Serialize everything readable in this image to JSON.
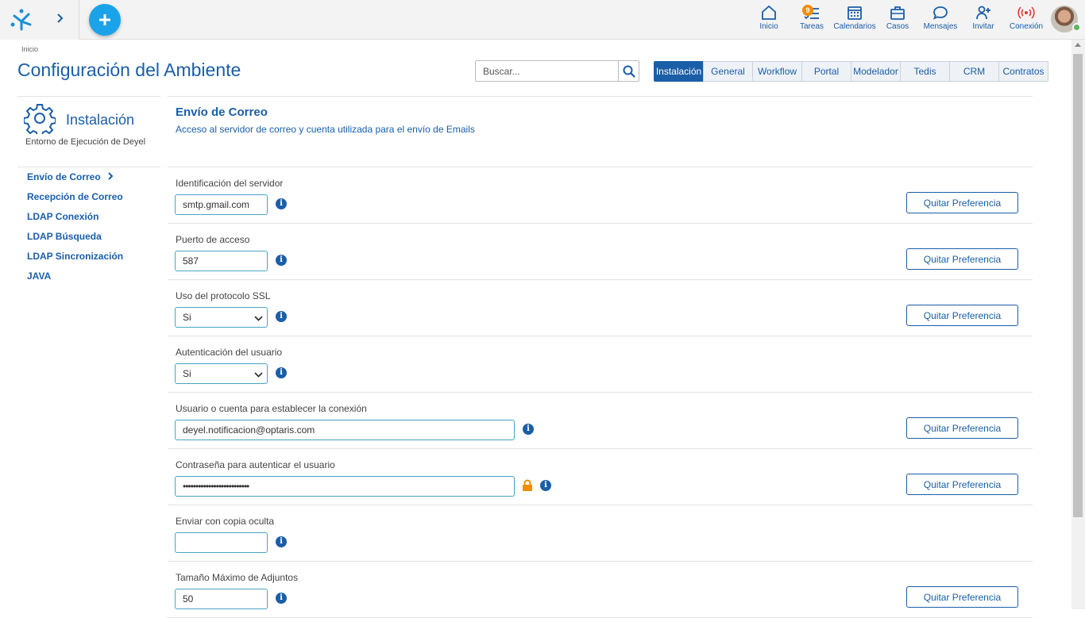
{
  "topbar": {
    "nav": [
      {
        "label": "Inicio",
        "icon": "home-icon"
      },
      {
        "label": "Tareas",
        "icon": "tasks-icon",
        "badge": "9"
      },
      {
        "label": "Calendarios",
        "icon": "calendar-icon"
      },
      {
        "label": "Casos",
        "icon": "briefcase-icon"
      },
      {
        "label": "Mensajes",
        "icon": "chat-icon"
      },
      {
        "label": "Invitar",
        "icon": "add-user-icon"
      },
      {
        "label": "Conexión",
        "icon": "connection-icon"
      }
    ],
    "accent": "#1aa3e8",
    "connection_color": "#e53935",
    "online_color": "#5cb85c"
  },
  "breadcrumb": "Inicio",
  "page_title": "Configuración del Ambiente",
  "search": {
    "placeholder": "Buscar..."
  },
  "tabs": [
    {
      "label": "Instalación",
      "active": true
    },
    {
      "label": "General"
    },
    {
      "label": "Workflow"
    },
    {
      "label": "Portal"
    },
    {
      "label": "Modelador"
    },
    {
      "label": "Tedis"
    },
    {
      "label": "CRM"
    },
    {
      "label": "Contratos"
    }
  ],
  "sidebar": {
    "title": "Instalación",
    "subtitle": "Entorno de Ejecución de Deyel",
    "items": [
      {
        "label": "Envío de Correo",
        "active": true
      },
      {
        "label": "Recepción de Correo"
      },
      {
        "label": "LDAP Conexión"
      },
      {
        "label": "LDAP Búsqueda"
      },
      {
        "label": "LDAP Sincronización"
      },
      {
        "label": "JAVA"
      }
    ]
  },
  "section": {
    "title": "Envío de Correo",
    "description": "Acceso al servidor de correo y cuenta utilizada para el envío de Emails"
  },
  "quitar_label": "Quitar Preferencia",
  "fields": [
    {
      "label": "Identificación del servidor",
      "type": "text",
      "size": "short",
      "value": "smtp.gmail.com",
      "quitar": true
    },
    {
      "label": "Puerto de acceso",
      "type": "text",
      "size": "short",
      "value": "587",
      "quitar": true
    },
    {
      "label": "Uso del protocolo SSL",
      "type": "select",
      "value": "Si",
      "quitar": true
    },
    {
      "label": "Autenticación del usuario",
      "type": "select",
      "value": "Si",
      "quitar": false
    },
    {
      "label": "Usuario o cuenta para establecer la conexión",
      "type": "text",
      "size": "long",
      "value": "deyel.notificacion@optaris.com",
      "quitar": true
    },
    {
      "label": "Contraseña para autenticar el usuario",
      "type": "password",
      "size": "long",
      "value": "••••••••••••••••••••••••••",
      "quitar": true,
      "lock": true
    },
    {
      "label": "Enviar con copia oculta",
      "type": "text",
      "size": "short",
      "value": "",
      "quitar": false
    },
    {
      "label": "Tamaño Máximo de Adjuntos",
      "type": "text",
      "size": "short",
      "value": "50",
      "quitar": true
    }
  ]
}
